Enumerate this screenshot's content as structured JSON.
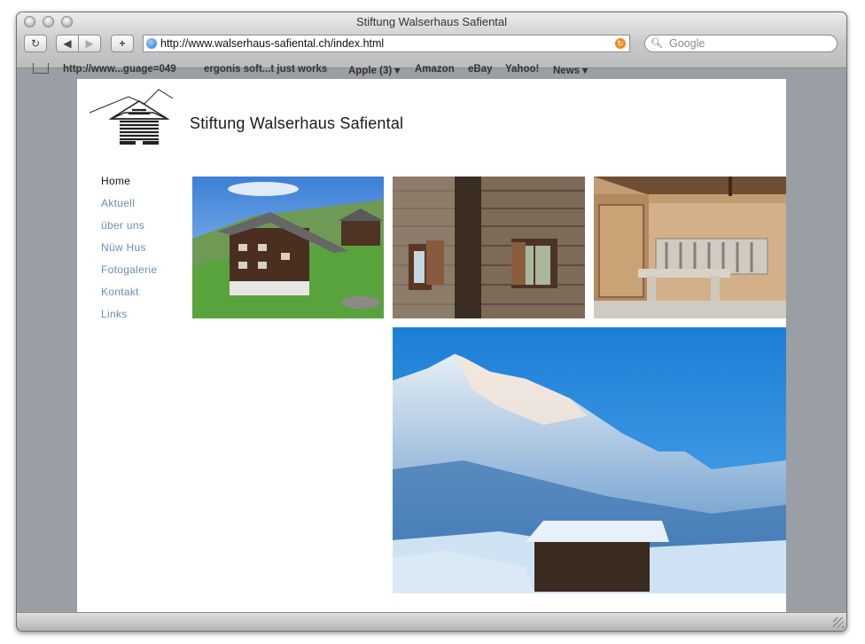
{
  "window": {
    "title": "Stiftung Walserhaus Safiental"
  },
  "toolbar": {
    "reload_label": "↻",
    "back_label": "◀",
    "forward_label": "▶",
    "add_label": "+",
    "url": "http://www.walserhaus-safiental.ch/index.html",
    "search_placeholder": "Google"
  },
  "bookmarks": [
    "http://www...guage=049",
    "ergonis soft...t just works",
    "Apple (3) ▾",
    "Amazon",
    "eBay",
    "Yahoo!",
    "News ▾"
  ],
  "site": {
    "title": "Stiftung Walserhaus Safiental",
    "nav": [
      "Home",
      "Aktuell",
      "über uns",
      "Nüw Hus",
      "Fotogalerie",
      "Kontakt",
      "Links"
    ],
    "active_nav": "Home"
  },
  "colors": {
    "nav_link": "#6a8fb3",
    "nav_active": "#111111",
    "chrome_bg": "#9a9ea5"
  }
}
